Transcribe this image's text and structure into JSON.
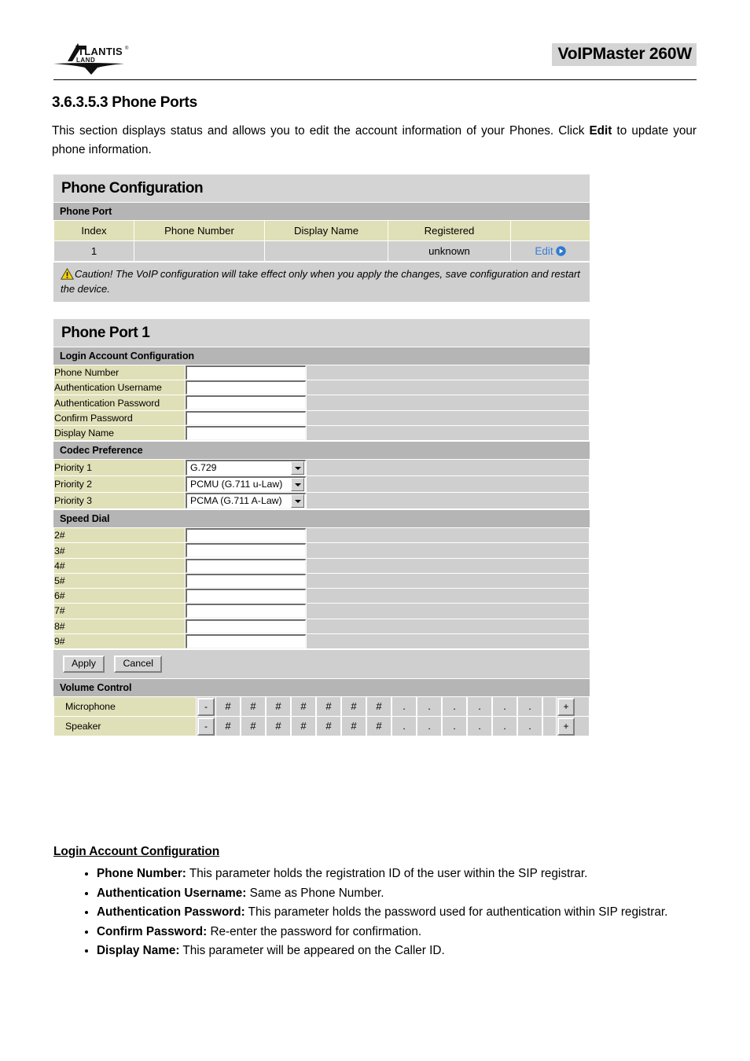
{
  "header": {
    "model": "VoIPMaster 260W",
    "logo_brand": "ATLANTIS",
    "logo_sub": "LAND",
    "logo_reg": "®"
  },
  "section": {
    "heading": "3.6.3.5.3 Phone Ports",
    "intro_part1": "This section displays status and allows you to edit the account information of your Phones. Click ",
    "intro_bold": "Edit",
    "intro_part2": " to update your phone information."
  },
  "phone_configuration": {
    "title": "Phone Configuration",
    "section_bar": "Phone Port",
    "columns": [
      "Index",
      "Phone Number",
      "Display Name",
      "Registered",
      ""
    ],
    "rows": [
      {
        "index": "1",
        "phone_number": "",
        "display_name": "",
        "registered": "unknown",
        "action": "Edit"
      }
    ],
    "caution": "Caution! The VoIP configuration will take effect only when you apply the changes, save configuration and restart the device."
  },
  "phone_port": {
    "title": "Phone Port 1",
    "login_section": "Login Account Configuration",
    "login_fields": [
      {
        "label": "Phone Number",
        "value": ""
      },
      {
        "label": "Authentication Username",
        "value": ""
      },
      {
        "label": "Authentication Password",
        "value": ""
      },
      {
        "label": "Confirm Password",
        "value": ""
      },
      {
        "label": "Display Name",
        "value": ""
      }
    ],
    "codec_section": "Codec Preference",
    "codec_rows": [
      {
        "label": "Priority 1",
        "value": "G.729"
      },
      {
        "label": "Priority 2",
        "value": "PCMU (G.711 u-Law)"
      },
      {
        "label": "Priority 3",
        "value": "PCMA (G.711 A-Law)"
      }
    ],
    "speed_dial_section": "Speed Dial",
    "speed_dial_rows": [
      {
        "label": "2#",
        "value": ""
      },
      {
        "label": "3#",
        "value": ""
      },
      {
        "label": "4#",
        "value": ""
      },
      {
        "label": "5#",
        "value": ""
      },
      {
        "label": "6#",
        "value": ""
      },
      {
        "label": "7#",
        "value": ""
      },
      {
        "label": "8#",
        "value": ""
      },
      {
        "label": "9#",
        "value": ""
      }
    ],
    "apply_label": "Apply",
    "cancel_label": "Cancel",
    "volume_section": "Volume Control",
    "volume_rows": [
      {
        "label": "Microphone",
        "minus": "-",
        "plus": "+",
        "filled": 7,
        "empty": 6,
        "filled_glyph": "#",
        "empty_glyph": "."
      },
      {
        "label": "Speaker",
        "minus": "-",
        "plus": "+",
        "filled": 7,
        "empty": 6,
        "filled_glyph": "#",
        "empty_glyph": "."
      }
    ]
  },
  "description": {
    "heading": "Login Account Configuration",
    "items": [
      {
        "term": "Phone Number:",
        "text": " This parameter holds the registration ID of the user within the SIP registrar."
      },
      {
        "term": "Authentication Username:",
        "text": " Same as Phone Number."
      },
      {
        "term": "Authentication Password:",
        "text": " This parameter holds the password used for authentication within SIP registrar."
      },
      {
        "term": "Confirm Password:",
        "text": " Re-enter the password for confirmation."
      },
      {
        "term": "Display Name:",
        "text": " This parameter will be appeared on the Caller ID."
      }
    ]
  },
  "colors": {
    "label_khaki": "#e0e0b8",
    "field_gray": "#cfcfcf",
    "section_gray": "#b5b5b5",
    "panel_gray": "#d4d4d4",
    "link_blue": "#3a7fd5",
    "warn_yellow": "#ffd700"
  }
}
